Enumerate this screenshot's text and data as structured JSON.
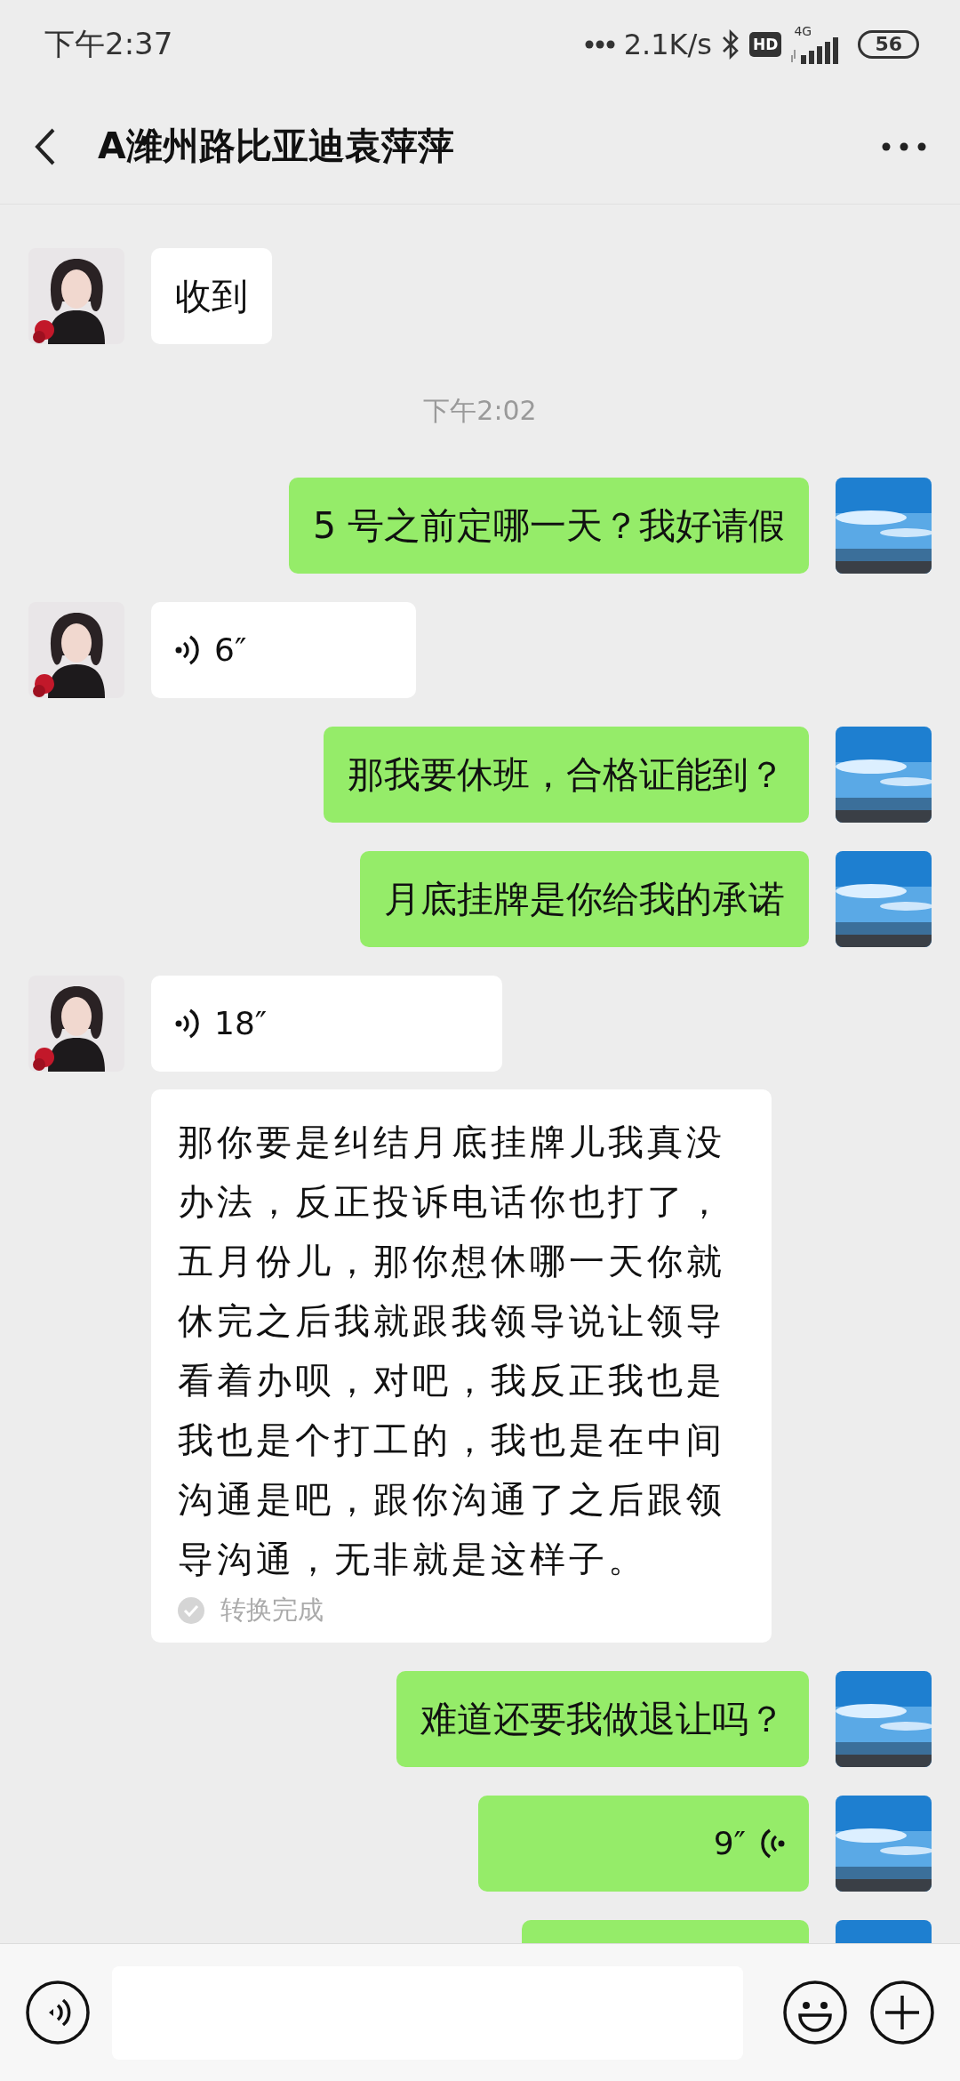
{
  "status_bar": {
    "time": "下午2:37",
    "net_speed": "2.1K/s",
    "hd": "HD",
    "network": "4G",
    "battery": "56"
  },
  "header": {
    "title": "A潍州路比亚迪袁萍萍"
  },
  "messages": [
    {
      "mine": false,
      "kind": "text",
      "text": "收到"
    },
    {
      "kind": "time",
      "text": "下午2:02"
    },
    {
      "mine": true,
      "kind": "text",
      "text": "5 号之前定哪一天？我好请假"
    },
    {
      "mine": false,
      "kind": "voice",
      "duration": "6″"
    },
    {
      "mine": true,
      "kind": "text",
      "text": "那我要休班，合格证能到？"
    },
    {
      "mine": true,
      "kind": "text",
      "text": "月底挂牌是你给我的承诺"
    },
    {
      "mine": false,
      "kind": "voice",
      "duration": "18″"
    },
    {
      "mine": false,
      "kind": "transcript",
      "text": "那你要是纠结月底挂牌儿我真没办法，反正投诉电话你也打了，五月份儿，那你想休哪一天你就休完之后我就跟我领导说让领导看着办呗，对吧，我反正我也是我也是个打工的，我也是在中间沟通是吧，跟你沟通了之后跟领导沟通，无非就是这样子。",
      "status": "转换完成"
    },
    {
      "mine": true,
      "kind": "text",
      "text": "难道还要我做退让吗？"
    },
    {
      "mine": true,
      "kind": "voice",
      "duration": "9″"
    },
    {
      "mine": true,
      "kind": "clipped"
    }
  ]
}
